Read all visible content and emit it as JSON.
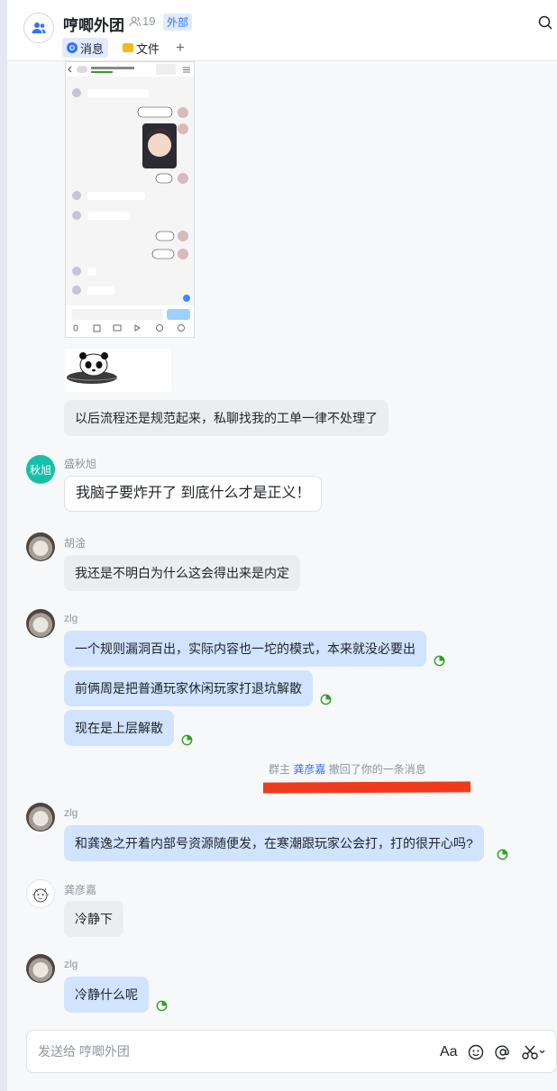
{
  "header": {
    "title": "哼唧外团",
    "member_count": "19",
    "badge": "外部",
    "tabs": [
      {
        "label": "消息",
        "active": true
      },
      {
        "label": "文件",
        "active": false
      }
    ],
    "add_tab_label": "+"
  },
  "embedded_screenshot": {
    "lines": [
      "哈哈我又花得很好了",
      "你这好好的吗",
      "？",
      "要说什么"
    ]
  },
  "messages": [
    {
      "sender": "",
      "text": "以后流程还是规范起来，私聊找我的工单一律不处理了",
      "style": "grey"
    },
    {
      "sender": "盛秋旭",
      "avatar_text": "秋旭",
      "text": "我脑子要炸开了 到底什么才是正义！",
      "style": "white"
    },
    {
      "sender": "胡淦",
      "text": "我还是不明白为什么这会得出来是内定",
      "style": "grey"
    },
    {
      "sender": "zlg",
      "text": "一个规则漏洞百出，实际内容也一坨的模式，本来就没必要出",
      "style": "blue"
    },
    {
      "sender": "",
      "text": "前俩周是把普通玩家休闲玩家打退坑解散",
      "style": "blue"
    },
    {
      "sender": "",
      "text": "现在是上层解散",
      "style": "blue"
    },
    {
      "sender": "zlg",
      "text": "和龚逸之开着内部号资源随便发，在寒潮跟玩家公会打，打的很开心吗?",
      "style": "blue"
    },
    {
      "sender": "龚彦嘉",
      "text": "冷静下",
      "style": "grey"
    },
    {
      "sender": "zlg",
      "text": "冷静什么呢",
      "style": "blue"
    }
  ],
  "system_note": {
    "prefix": "群主",
    "name": "龚彦嘉",
    "suffix": "撤回了你的一条消息"
  },
  "composer": {
    "placeholder": "发送给 哼唧外团",
    "text_format_label": "Aa"
  },
  "colors": {
    "accent": "#3370ff",
    "bubble_blue": "#d1e3ff",
    "bubble_grey": "#ebedf0",
    "read_green": "#2ea121",
    "redaction_red": "#ee3b1d"
  }
}
